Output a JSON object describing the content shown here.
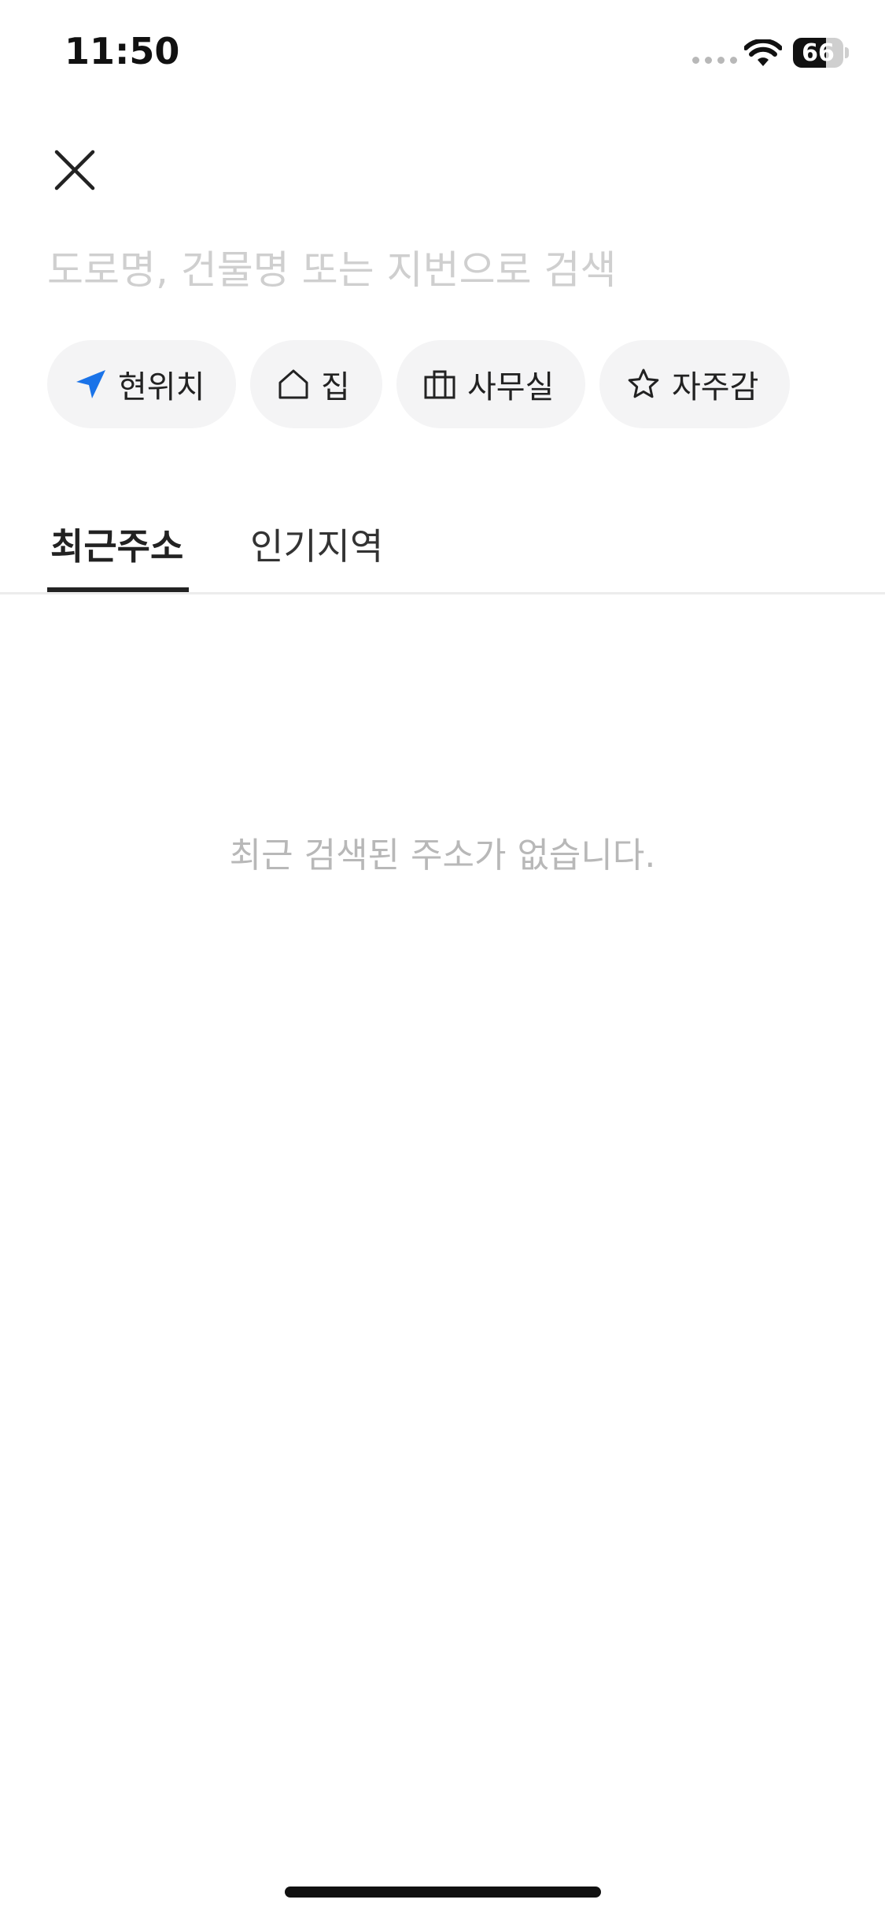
{
  "status_bar": {
    "time": "11:50",
    "battery_percent": "66",
    "battery_level": 0.66
  },
  "search": {
    "placeholder": "도로명, 건물명 또는 지번으로 검색",
    "value": ""
  },
  "quick_chips": [
    {
      "label": "현위치",
      "icon": "location-arrow-icon",
      "icon_color": "#1a73e8"
    },
    {
      "label": "집",
      "icon": "home-icon"
    },
    {
      "label": "사무실",
      "icon": "briefcase-icon"
    },
    {
      "label": "자주감",
      "icon": "star-icon"
    }
  ],
  "tabs": [
    {
      "label": "최근주소",
      "active": true
    },
    {
      "label": "인기지역",
      "active": false
    }
  ],
  "empty_state": {
    "message": "최근 검색된 주소가 없습니다."
  },
  "colors": {
    "accent": "#1a73e8",
    "placeholder": "#cfcfcf",
    "chip_bg": "#f4f4f5",
    "empty_text": "#b8b8b8"
  }
}
